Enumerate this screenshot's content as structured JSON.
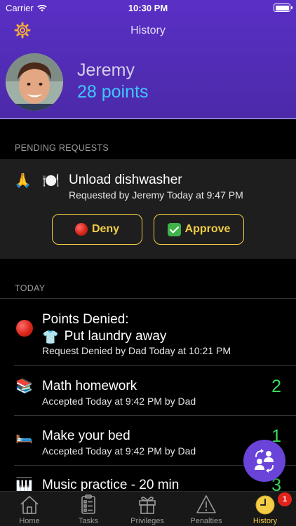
{
  "status_bar": {
    "carrier": "Carrier",
    "time": "10:30 PM"
  },
  "nav": {
    "title": "History"
  },
  "profile": {
    "name": "Jeremy",
    "points": "28 points"
  },
  "pending": {
    "section_label": "PENDING REQUESTS",
    "request": {
      "icons": [
        "🙏",
        "🍽️"
      ],
      "title": "Unload dishwasher",
      "subtitle": "Requested by Jeremy Today at 9:47 PM"
    },
    "deny_label": "Deny",
    "approve_label": "Approve"
  },
  "today": {
    "section_label": "TODAY",
    "items": [
      {
        "icon": "red-dot",
        "title": "Points Denied:",
        "title2_icon": "👕",
        "title2": "Put laundry away",
        "subtitle": "Request Denied by Dad Today at 10:21 PM",
        "points": ""
      },
      {
        "icon": "📚",
        "title": "Math homework",
        "subtitle": "Accepted Today at 9:42 PM by Dad",
        "points": "2"
      },
      {
        "icon": "🛏️",
        "title": "Make your bed",
        "subtitle": "Accepted Today at 9:42 PM by Dad",
        "points": "1"
      },
      {
        "icon": "🎹",
        "title": "Music practice - 20 min",
        "subtitle": "",
        "points": "3"
      }
    ]
  },
  "tabbar": {
    "tabs": [
      {
        "label": "Home",
        "icon": "house-icon"
      },
      {
        "label": "Tasks",
        "icon": "clipboard-icon"
      },
      {
        "label": "Privileges",
        "icon": "gift-icon"
      },
      {
        "label": "Penalties",
        "icon": "warning-icon"
      },
      {
        "label": "History",
        "icon": "clock-icon",
        "active": true
      }
    ],
    "history_badge": "1"
  },
  "colors": {
    "header": "#5a2fc6",
    "accent": "#f2cd45",
    "points": "#41c6ff",
    "earned": "#3ddc62",
    "badge": "#e3231b"
  }
}
